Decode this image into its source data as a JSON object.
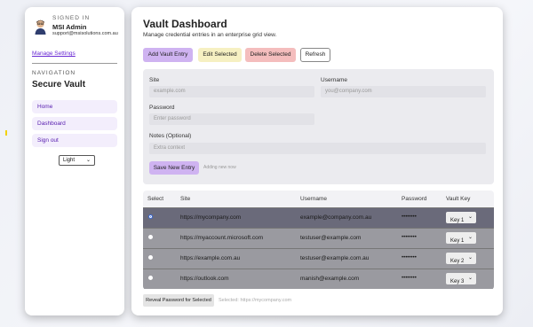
{
  "user": {
    "signed_in_label": "SIGNED IN",
    "name": "MSI Admin",
    "email": "support@msisolutions.com.au",
    "manage_settings": "Manage Settings"
  },
  "sidebar": {
    "nav_label": "NAVIGATION",
    "app_title": "Secure Vault",
    "items": [
      {
        "label": "Home"
      },
      {
        "label": "Dashboard"
      },
      {
        "label": "Sign out"
      }
    ],
    "theme_value": "Light"
  },
  "main": {
    "title": "Vault Dashboard",
    "subtitle": "Manage credential entries in an enterprise grid view."
  },
  "toolbar": {
    "add_label": "Add Vault Entry",
    "edit_label": "Edit Selected",
    "delete_label": "Delete Selected",
    "refresh_label": "Refresh"
  },
  "form": {
    "site_label": "Site",
    "site_placeholder": "example.com",
    "username_label": "Username",
    "username_placeholder": "you@company.com",
    "password_label": "Password",
    "password_placeholder": "Enter password",
    "notes_label": "Notes (Optional)",
    "notes_placeholder": "Extra context",
    "save_label": "Save New Entry",
    "mode_note": "Adding new now"
  },
  "grid": {
    "headers": [
      "Select",
      "Site",
      "Username",
      "Password",
      "Vault Key"
    ],
    "rows": [
      {
        "site": "https://mycompany.com",
        "username": "example@company.com.au",
        "password": "••••••••",
        "key": "Key 1",
        "selected": true
      },
      {
        "site": "https://myaccount.microsoft.com",
        "username": "testuser@example.com",
        "password": "••••••••",
        "key": "Key 1",
        "selected": false
      },
      {
        "site": "https://example.com.au",
        "username": "testuser@example.com.au",
        "password": "••••••••",
        "key": "Key 2",
        "selected": false
      },
      {
        "site": "https://outlook.com",
        "username": "manish@example.com",
        "password": "••••••••",
        "key": "Key 3",
        "selected": false
      }
    ]
  },
  "footer": {
    "reveal_label": "Reveal Password for Selected",
    "selected_note": "Selected: https://mycompany.com"
  },
  "colors": {
    "accent": "#cfb3f1",
    "selected_row": "#6a6a7a",
    "row": "#9a9aa0"
  }
}
